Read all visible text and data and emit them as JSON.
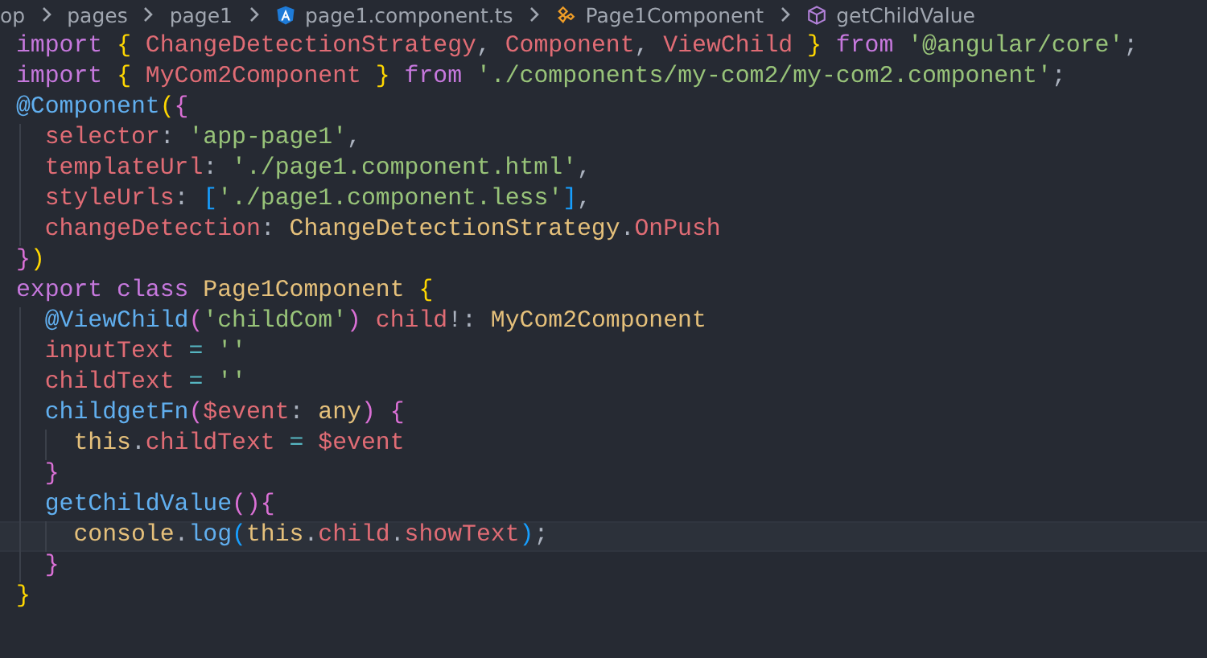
{
  "breadcrumb": [
    {
      "label": "op",
      "kind": "folder"
    },
    {
      "label": "pages",
      "kind": "folder"
    },
    {
      "label": "page1",
      "kind": "folder"
    },
    {
      "label": "page1.component.ts",
      "kind": "file"
    },
    {
      "label": "Page1Component",
      "kind": "class"
    },
    {
      "label": "getChildValue",
      "kind": "method"
    }
  ],
  "code_lines": [
    {
      "current": false,
      "tokens": [
        {
          "text": "import ",
          "kind": "keyword"
        },
        {
          "text": "{",
          "kind": "bracket1"
        },
        {
          "text": " ChangeDetectionStrategy",
          "kind": "variable"
        },
        {
          "text": ", ",
          "kind": "punctuation"
        },
        {
          "text": "Component",
          "kind": "variable"
        },
        {
          "text": ", ",
          "kind": "punctuation"
        },
        {
          "text": "ViewChild ",
          "kind": "variable"
        },
        {
          "text": "}",
          "kind": "bracket1"
        },
        {
          "text": " from ",
          "kind": "keyword"
        },
        {
          "text": "'@angular/core'",
          "kind": "string"
        },
        {
          "text": ";",
          "kind": "punctuation"
        }
      ]
    },
    {
      "current": false,
      "tokens": [
        {
          "text": "import ",
          "kind": "keyword"
        },
        {
          "text": "{",
          "kind": "bracket1"
        },
        {
          "text": " MyCom2Component ",
          "kind": "variable"
        },
        {
          "text": "}",
          "kind": "bracket1"
        },
        {
          "text": " from ",
          "kind": "keyword"
        },
        {
          "text": "'./components/my-com2/my-com2.component'",
          "kind": "string"
        },
        {
          "text": ";",
          "kind": "punctuation"
        }
      ]
    },
    {
      "current": false,
      "tokens": [
        {
          "text": "@Component",
          "kind": "function"
        },
        {
          "text": "(",
          "kind": "bracket1"
        },
        {
          "text": "{",
          "kind": "bracket2"
        }
      ],
      "children": [
        {
          "current": false,
          "tokens": [
            {
              "text": "selector",
              "kind": "variable"
            },
            {
              "text": ": ",
              "kind": "punctuation"
            },
            {
              "text": "'app-page1'",
              "kind": "string"
            },
            {
              "text": ",",
              "kind": "punctuation"
            }
          ]
        },
        {
          "current": false,
          "tokens": [
            {
              "text": "templateUrl",
              "kind": "variable"
            },
            {
              "text": ": ",
              "kind": "punctuation"
            },
            {
              "text": "'./page1.component.html'",
              "kind": "string"
            },
            {
              "text": ",",
              "kind": "punctuation"
            }
          ]
        },
        {
          "current": false,
          "tokens": [
            {
              "text": "styleUrls",
              "kind": "variable"
            },
            {
              "text": ": ",
              "kind": "punctuation"
            },
            {
              "text": "[",
              "kind": "bracket3"
            },
            {
              "text": "'./page1.component.less'",
              "kind": "string"
            },
            {
              "text": "]",
              "kind": "bracket3"
            },
            {
              "text": ",",
              "kind": "punctuation"
            }
          ]
        },
        {
          "current": false,
          "tokens": [
            {
              "text": "changeDetection",
              "kind": "variable"
            },
            {
              "text": ": ",
              "kind": "punctuation"
            },
            {
              "text": "ChangeDetectionStrategy",
              "kind": "type"
            },
            {
              "text": ".",
              "kind": "punctuation"
            },
            {
              "text": "OnPush",
              "kind": "variable"
            }
          ]
        }
      ]
    },
    {
      "current": false,
      "tokens": [
        {
          "text": "}",
          "kind": "bracket2"
        },
        {
          "text": ")",
          "kind": "bracket1"
        }
      ]
    },
    {
      "current": false,
      "tokens": [
        {
          "text": "export class ",
          "kind": "keyword"
        },
        {
          "text": "Page1Component ",
          "kind": "type"
        },
        {
          "text": "{",
          "kind": "bracket1"
        }
      ],
      "children": [
        {
          "current": false,
          "tokens": [
            {
              "text": "@ViewChild",
              "kind": "function"
            },
            {
              "text": "(",
              "kind": "bracket2"
            },
            {
              "text": "'childCom'",
              "kind": "string"
            },
            {
              "text": ")",
              "kind": "bracket2"
            },
            {
              "text": " child",
              "kind": "variable"
            },
            {
              "text": "!: ",
              "kind": "punctuation"
            },
            {
              "text": "MyCom2Component",
              "kind": "type"
            }
          ]
        },
        {
          "current": false,
          "tokens": [
            {
              "text": "inputText",
              "kind": "variable"
            },
            {
              "text": " = ",
              "kind": "operator"
            },
            {
              "text": "''",
              "kind": "string"
            }
          ]
        },
        {
          "current": false,
          "tokens": [
            {
              "text": "childText",
              "kind": "variable"
            },
            {
              "text": " = ",
              "kind": "operator"
            },
            {
              "text": "''",
              "kind": "string"
            }
          ]
        },
        {
          "current": false,
          "tokens": [
            {
              "text": "childgetFn",
              "kind": "function"
            },
            {
              "text": "(",
              "kind": "bracket2"
            },
            {
              "text": "$event",
              "kind": "variable"
            },
            {
              "text": ": ",
              "kind": "punctuation"
            },
            {
              "text": "any",
              "kind": "type"
            },
            {
              "text": ")",
              "kind": "bracket2"
            },
            {
              "text": " {",
              "kind": "bracket2"
            }
          ],
          "children": [
            {
              "current": false,
              "tokens": [
                {
                  "text": "this",
                  "kind": "type"
                },
                {
                  "text": ".",
                  "kind": "punctuation"
                },
                {
                  "text": "childText",
                  "kind": "variable"
                },
                {
                  "text": " = ",
                  "kind": "operator"
                },
                {
                  "text": "$event",
                  "kind": "variable"
                }
              ]
            }
          ]
        },
        {
          "current": false,
          "tokens": [
            {
              "text": "}",
              "kind": "bracket2"
            }
          ]
        },
        {
          "current": false,
          "tokens": [
            {
              "text": "getChildValue",
              "kind": "function"
            },
            {
              "text": "()",
              "kind": "bracket2"
            },
            {
              "text": "{",
              "kind": "bracket2"
            }
          ],
          "children": [
            {
              "current": true,
              "tokens": [
                {
                  "text": "console",
                  "kind": "type"
                },
                {
                  "text": ".",
                  "kind": "punctuation"
                },
                {
                  "text": "log",
                  "kind": "function"
                },
                {
                  "text": "(",
                  "kind": "bracket3"
                },
                {
                  "text": "this",
                  "kind": "type"
                },
                {
                  "text": ".",
                  "kind": "punctuation"
                },
                {
                  "text": "child",
                  "kind": "variable"
                },
                {
                  "text": ".",
                  "kind": "punctuation"
                },
                {
                  "text": "showText",
                  "kind": "variable"
                },
                {
                  "text": ")",
                  "kind": "bracket3"
                },
                {
                  "text": ";",
                  "kind": "punctuation"
                }
              ]
            }
          ]
        },
        {
          "current": false,
          "tokens": [
            {
              "text": "}",
              "kind": "bracket2"
            }
          ]
        }
      ]
    },
    {
      "current": false,
      "tokens": [
        {
          "text": "}",
          "kind": "bracket1"
        }
      ]
    }
  ]
}
